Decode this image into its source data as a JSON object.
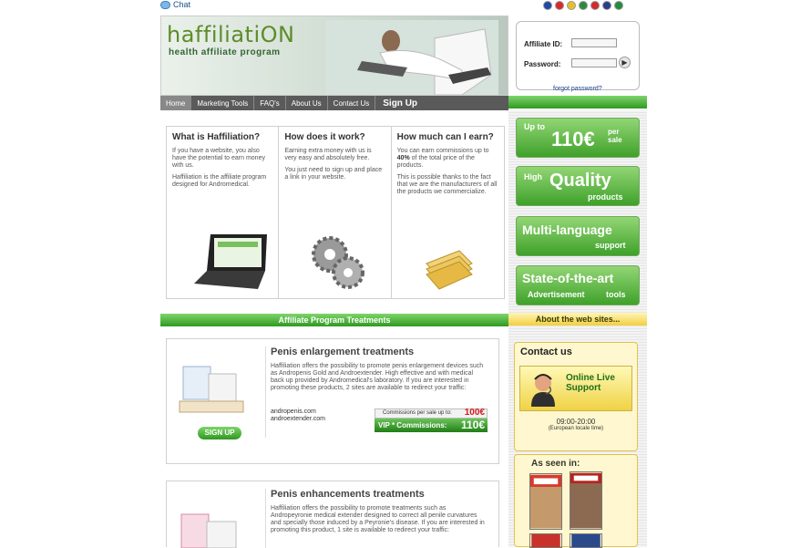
{
  "topbar": {
    "chat_label": "Chat",
    "flags": [
      "#1f4ba3",
      "#d72b2b",
      "#e4c02c",
      "#2c8b3b",
      "#d12c2c",
      "#2a3f8a",
      "#238b3c"
    ]
  },
  "brand": {
    "logo": "haffiliatiON",
    "tagline": "health affiliate program"
  },
  "nav": {
    "items": [
      "Home",
      "Marketing Tools",
      "FAQ's",
      "About Us",
      "Contact Us"
    ],
    "signup": "Sign Up"
  },
  "login": {
    "id_label": "Affiliate ID:",
    "password_label": "Password:",
    "forgot": "forgot password?"
  },
  "promos": [
    {
      "small": "Up to",
      "big": "110€",
      "sub": "per sale"
    },
    {
      "small": "High",
      "big": "Quality",
      "sub": "products"
    },
    {
      "big": "Multi-language",
      "sub": "support"
    },
    {
      "big": "State-of-the-art",
      "sub": "Advertisement",
      "sub2": "tools"
    }
  ],
  "intro": {
    "col1": {
      "title": "What is Haffiliation?",
      "p1": "If you have a website, you also have the potential to earn money with us.",
      "p2": "Haffiliation is the affiliate program designed for Andromedical."
    },
    "col2": {
      "title": "How does it work?",
      "p1": "Earning extra money with us is very easy and absolutely free.",
      "p2": "You just need to sign up and place a link in your website."
    },
    "col3": {
      "title": "How much can I earn?",
      "p1a": "You can earn commissions up to ",
      "p1b": "40%",
      "p1c": " of the total price of the products.",
      "p2": "This is possible thanks to the fact that we are the manufacturers of all the products we commercialize."
    }
  },
  "sections": {
    "treatments": "Affiliate Program Treatments",
    "about": "About the web sites..."
  },
  "products": [
    {
      "title": "Penis enlargement treatments",
      "desc": "Haffiliation offers the possibility to promote penis enlargement devices such as Andropenis Gold and Androextender. High effective and with medical back up provided by Andromedical's laboratory. If you are interested in promoting these products, 2 sites are available to redirect your traffic:",
      "sites": [
        "andropenis.com",
        "androextender.com"
      ],
      "comm_label": "Commissions per sale up to:",
      "comm_value": "100€",
      "vip_label": "VIP * Commissions:",
      "vip_value": "110€",
      "signup": "SIGN UP"
    },
    {
      "title": "Penis enhancements treatments",
      "desc": "Haffiliation offers the possibility to promote treatments such as Andropeyronie medical extender designed to correct all penile curvatures and specially those induced by a Peyronie's disease. If you are interested in promoting this product, 1 site is available to redirect your traffic:"
    }
  ],
  "contact": {
    "title": "Contact us",
    "support": "Online Live Support",
    "hours": "09:00-20:00",
    "hours_note": "(European locale time)"
  },
  "asseen": {
    "title": "As seen in:"
  }
}
